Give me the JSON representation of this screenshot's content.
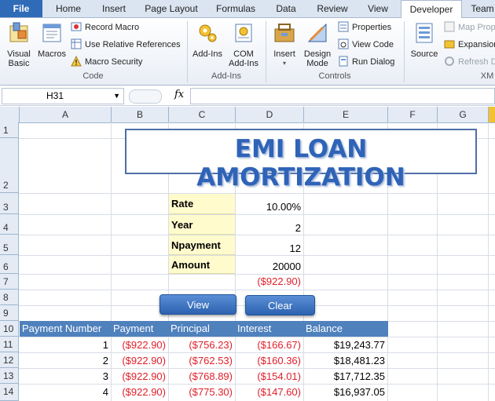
{
  "ribbon": {
    "tabs": [
      "File",
      "Home",
      "Insert",
      "Page Layout",
      "Formulas",
      "Data",
      "Review",
      "View",
      "Developer",
      "Team"
    ],
    "active_tab": "Developer",
    "code": {
      "label": "Code",
      "visual_basic": "Visual Basic",
      "macros": "Macros",
      "record_macro": "Record Macro",
      "use_relative": "Use Relative References",
      "macro_security": "Macro Security"
    },
    "addins": {
      "label": "Add-Ins",
      "addins": "Add-Ins",
      "com_addins": "COM Add-Ins"
    },
    "controls": {
      "label": "Controls",
      "insert": "Insert",
      "design_mode": "Design Mode",
      "properties": "Properties",
      "view_code": "View Code",
      "run_dialog": "Run Dialog"
    },
    "xml": {
      "label": "XM",
      "source": "Source",
      "map_properties": "Map Prop",
      "expansion": "Expansion",
      "refresh": "Refresh D"
    }
  },
  "formula_bar": {
    "name_box": "H31",
    "fx": "fx",
    "formula": ""
  },
  "columns": [
    "A",
    "B",
    "C",
    "D",
    "E",
    "F",
    "G"
  ],
  "rows": [
    "1",
    "2",
    "3",
    "4",
    "5",
    "6",
    "7",
    "8",
    "9",
    "10",
    "11",
    "12",
    "13",
    "14"
  ],
  "sheet": {
    "title": "EMI LOAN AMORTIZATION",
    "inputs": [
      {
        "label": "Rate",
        "value": "10.00%"
      },
      {
        "label": "Year",
        "value": "2"
      },
      {
        "label": "Npayment",
        "value": "12"
      },
      {
        "label": "Amount",
        "value": "20000"
      }
    ],
    "emi": "($922.90)",
    "view_button": "View",
    "clear_button": "Clear",
    "table_headers": [
      "Payment Number",
      "Payment",
      "Principal",
      "Interest",
      "Balance"
    ],
    "table_rows": [
      [
        "1",
        "($922.90)",
        "($756.23)",
        "($166.67)",
        "$19,243.77"
      ],
      [
        "2",
        "($922.90)",
        "($762.53)",
        "($160.36)",
        "$18,481.23"
      ],
      [
        "3",
        "($922.90)",
        "($768.89)",
        "($154.01)",
        "$17,712.35"
      ],
      [
        "4",
        "($922.90)",
        "($775.30)",
        "($147.60)",
        "$16,937.05"
      ]
    ]
  },
  "colors": {
    "accent": "#2f6bb7",
    "header_fill": "#4f81bd",
    "input_fill": "#fffbcd",
    "negative": "#e0202a",
    "title": "#2e63b7"
  }
}
